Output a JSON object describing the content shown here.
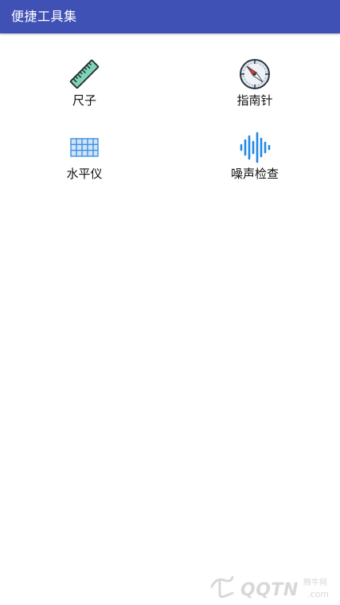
{
  "app_bar": {
    "title": "便捷工具集",
    "color": "#3f51b5"
  },
  "tools": [
    {
      "label": "尺子",
      "icon": "ruler-icon"
    },
    {
      "label": "指南针",
      "icon": "compass-icon"
    },
    {
      "label": "水平仪",
      "icon": "level-grid-icon"
    },
    {
      "label": "噪声检查",
      "icon": "sound-wave-icon"
    }
  ],
  "watermark": {
    "brand": "QQTN",
    "suffix": ".com",
    "site": "腾牛网"
  }
}
